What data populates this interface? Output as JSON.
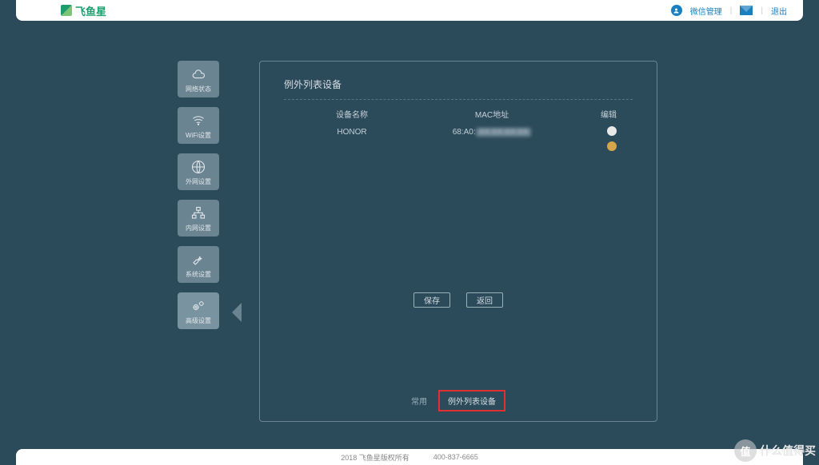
{
  "brand": "飞鱼星",
  "topbar": {
    "wechat_mgmt": "微信管理",
    "logout": "退出"
  },
  "sidebar": {
    "items": [
      {
        "label": "网络状态",
        "icon": "cloud"
      },
      {
        "label": "WiFi设置",
        "icon": "wifi"
      },
      {
        "label": "外网设置",
        "icon": "globe"
      },
      {
        "label": "内网设置",
        "icon": "network"
      },
      {
        "label": "系统设置",
        "icon": "wrench"
      },
      {
        "label": "高级设置",
        "icon": "gears"
      }
    ]
  },
  "panel": {
    "title": "例外列表设备",
    "columns": {
      "name": "设备名称",
      "mac": "MAC地址",
      "edit": "编辑"
    },
    "rows": [
      {
        "name": "HONOR",
        "mac_prefix": "68:A0:",
        "mac_hidden": "XX:XX:XX:XX"
      }
    ],
    "buttons": {
      "save": "保存",
      "back": "返回"
    },
    "tabs": {
      "common": "常用",
      "exception": "例外列表设备"
    }
  },
  "footer": {
    "copyright": "2018 飞鱼星版权所有",
    "phone": "400-837-6665"
  },
  "watermark": {
    "badge": "值",
    "text": "什么值得买"
  }
}
